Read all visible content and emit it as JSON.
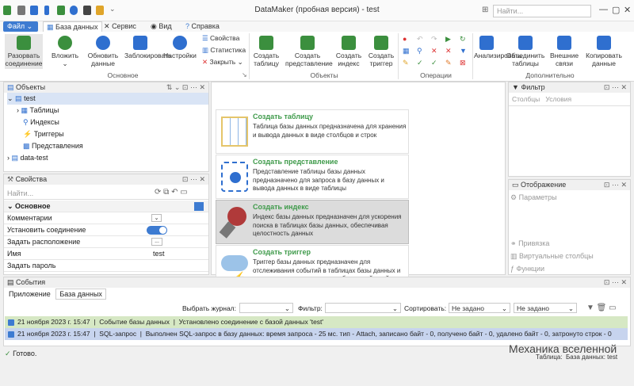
{
  "window": {
    "title": "DataMaker (пробная версия) - test",
    "search_placeholder": "Найти...",
    "controls": [
      "—",
      "▢",
      "✕"
    ]
  },
  "tabs": {
    "file": "Файл",
    "items": [
      "База данных",
      "Сервис",
      "Вид",
      "Справка"
    ]
  },
  "ribbon": {
    "disconnect": "Разорвать соединение",
    "attach": "Вложить",
    "refresh": "Обновить данные",
    "lock": "Заблокировать",
    "settings": "Настройки",
    "props": "Свойства",
    "stats": "Статистика",
    "close": "Закрыть",
    "group_main": "Основное",
    "create_table": "Создать таблицу",
    "create_view": "Создать представление",
    "create_index": "Создать индекс",
    "create_trigger": "Создать триггер",
    "group_objects": "Объекты",
    "group_ops": "Операции",
    "analyze": "Анализировать",
    "merge": "Объединить таблицы",
    "external": "Внешние связи",
    "copy_data": "Копировать данные",
    "group_extra": "Дополнительно"
  },
  "objects": {
    "title": "Объекты",
    "root": "test",
    "items": [
      "Таблицы",
      "Индексы",
      "Триггеры",
      "Представления"
    ],
    "other_db": "data-test"
  },
  "properties": {
    "title": "Свойства",
    "search_placeholder": "Найти...",
    "section": "Основное",
    "rows": [
      {
        "name": "Комментарии",
        "value": ""
      },
      {
        "name": "Установить соединение",
        "value": ""
      },
      {
        "name": "Задать расположение",
        "value": "..."
      },
      {
        "name": "Имя",
        "value": "test"
      },
      {
        "name": "Задать пароль",
        "value": ""
      }
    ]
  },
  "cards": [
    {
      "title": "Создать таблицу",
      "desc": "Таблица базы данных предназначена для хранения и вывода данных в виде столбцов и строк"
    },
    {
      "title": "Создать представление",
      "desc": "Представление таблицы базы данных предназначено для запроса в базу данных и вывода данных в виде таблицы"
    },
    {
      "title": "Создать индекс",
      "desc": "Индекс базы данных предназначен для ускорения поиска в таблицах базы данных, обеспечивая целостность данных"
    },
    {
      "title": "Создать триггер",
      "desc": "Триггер базы данных предназначен для отслеживания событий в таблицах базы данных и вызова заданных для этого события действий"
    }
  ],
  "filter": {
    "title": "Фильтр",
    "tabs": [
      "Столбцы",
      "Условия"
    ]
  },
  "display": {
    "title": "Отображение",
    "params": "Параметры",
    "items": [
      "Привязка",
      "Виртуальные столбцы",
      "Функции"
    ]
  },
  "events": {
    "title": "События",
    "tabs": [
      "Приложение",
      "База данных"
    ],
    "journal_label": "Выбрать журнал:",
    "filter_label": "Фильтр:",
    "sort_label": "Сортировать:",
    "sort1": "Не задано",
    "sort2": "Не задано",
    "rows": [
      {
        "date": "21 ноября 2023 г. 15:47",
        "type": "Событие базы данных",
        "msg": "Установлено соединение с базой данных 'test'"
      },
      {
        "date": "21 ноября 2023 г. 15:47",
        "type": "SQL-запрос",
        "msg": "Выполнен SQL-запрос в базу данных: время запроса - 25 мс. тип - Attach, записано байт - 0, получено байт - 0, удалено байт - 0, затронуто строк - 0"
      }
    ]
  },
  "status": {
    "ready": "Готово.",
    "table_label": "Таблица:",
    "db_label": "База данных: test"
  },
  "watermark": "Механика вселенной",
  "colors": {
    "accent": "#3d7bd1",
    "green": "#3e9a4a",
    "highlight_row": "#d6e8c4",
    "selected_row": "#c7d4ee"
  }
}
